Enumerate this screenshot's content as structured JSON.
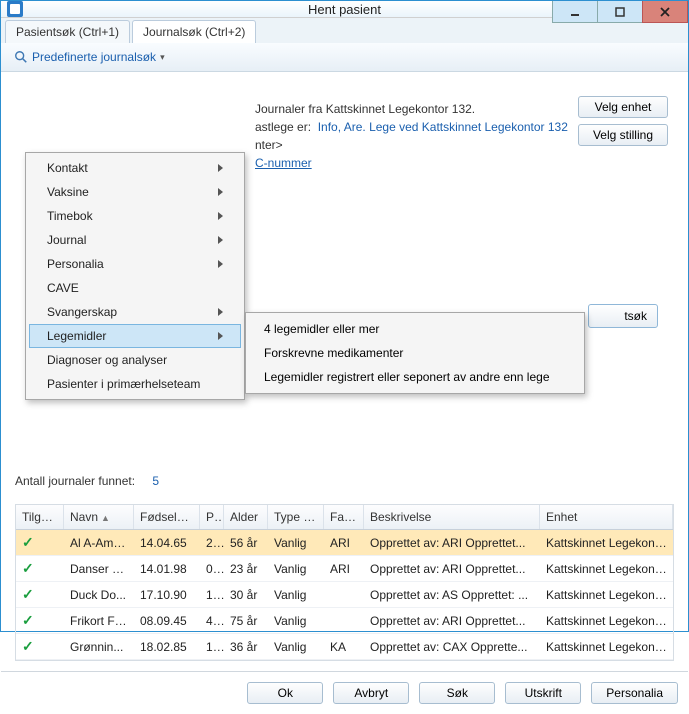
{
  "window": {
    "title": "Hent pasient"
  },
  "tabs": {
    "patient": "Pasientsøk (Ctrl+1)",
    "journal": "Journalsøk (Ctrl+2)"
  },
  "toolbar": {
    "predef": "Predefinerte journalsøk"
  },
  "menu": {
    "items": [
      {
        "label": "Kontakt",
        "sub": true
      },
      {
        "label": "Vaksine",
        "sub": true
      },
      {
        "label": "Timebok",
        "sub": true
      },
      {
        "label": "Journal",
        "sub": true
      },
      {
        "label": "Personalia",
        "sub": true
      },
      {
        "label": "CAVE",
        "sub": false
      },
      {
        "label": "Svangerskap",
        "sub": true
      },
      {
        "label": "Legemidler",
        "sub": true,
        "hover": true
      },
      {
        "label": "Diagnoser og analyser",
        "sub": false
      },
      {
        "label": "Pasienter i primærhelseteam",
        "sub": false
      }
    ]
  },
  "submenu": {
    "items": [
      "4 legemidler eller mer",
      "Forskrevne medikamenter",
      "Legemidler registrert eller seponert av andre enn lege"
    ]
  },
  "info": {
    "line1": "Journaler fra Kattskinnet Legekontor 132.",
    "fastlege_lbl": "astlege er:",
    "fastlege_val": "Info, Are. Lege ved Kattskinnet Legekontor 132",
    "nter": "nter>",
    "cnr": "C-nummer",
    "btn_enhet": "Velg enhet",
    "btn_stilling": "Velg stilling",
    "btn_sok_partial": "tsøk"
  },
  "count": {
    "label": "Antall journaler funnet:",
    "value": "5"
  },
  "grid": {
    "headers": {
      "tilgang": "Tilgang",
      "navn": "Navn",
      "fd": "Fødselsdat",
      "per": "Per",
      "alder": "Alder",
      "type": "Type journal",
      "fast": "Fast HP",
      "besk": "Beskrivelse",
      "enhet": "Enhet"
    },
    "rows": [
      {
        "navn": "Al A-Ama...",
        "fd": "14.04.65",
        "per": "2...",
        "alder": "56 år",
        "type": "Vanlig",
        "fast": "ARI",
        "besk": "Opprettet av: ARI Opprettet...",
        "enhet": "Kattskinnet Legekontor...",
        "sel": true
      },
      {
        "navn": "Danser F...",
        "fd": "14.01.98",
        "per": "0...",
        "alder": "23 år",
        "type": "Vanlig",
        "fast": "ARI",
        "besk": "Opprettet av: ARI Opprettet...",
        "enhet": "Kattskinnet Legekontor..."
      },
      {
        "navn": "Duck Do...",
        "fd": "17.10.90",
        "per": "1...",
        "alder": "30 år",
        "type": "Vanlig",
        "fast": "",
        "besk": "Opprettet av: AS Opprettet: ...",
        "enhet": "Kattskinnet Legekontor..."
      },
      {
        "navn": "Frikort Fe...",
        "fd": "08.09.45",
        "per": "4...",
        "alder": "75 år",
        "type": "Vanlig",
        "fast": "",
        "besk": "Opprettet av: ARI Opprettet...",
        "enhet": "Kattskinnet Legekontor..."
      },
      {
        "navn": "Grønnin...",
        "fd": "18.02.85",
        "per": "1...",
        "alder": "36 år",
        "type": "Vanlig",
        "fast": "KA",
        "besk": "Opprettet av: CAX Opprette...",
        "enhet": "Kattskinnet Legekontor..."
      }
    ]
  },
  "footer": {
    "ok": "Ok",
    "avbryt": "Avbryt",
    "sok": "Søk",
    "utskrift": "Utskrift",
    "personalia": "Personalia"
  }
}
